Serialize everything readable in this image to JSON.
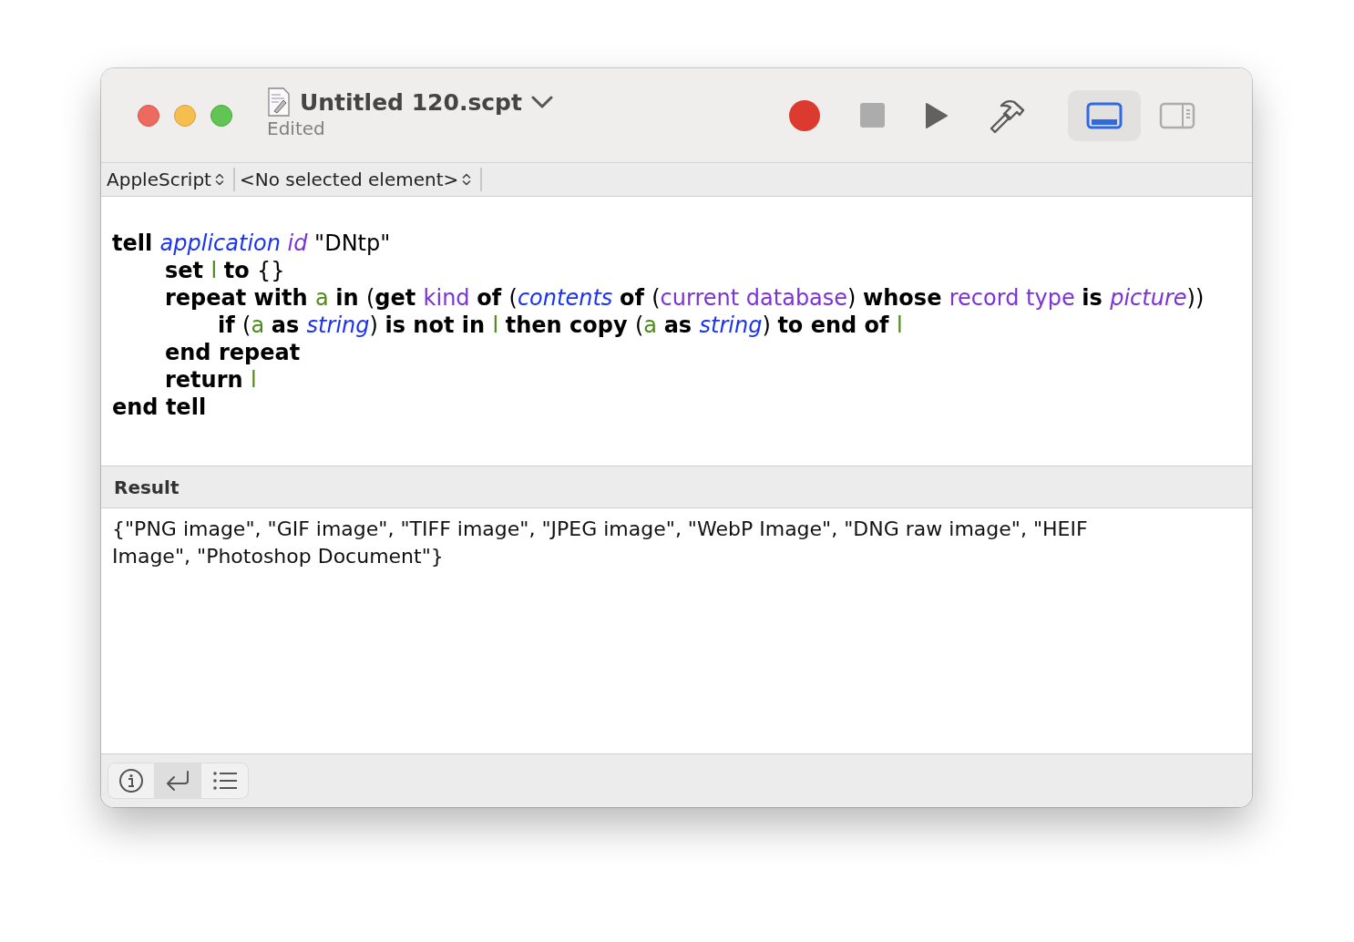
{
  "window": {
    "title": "Untitled 120.scpt",
    "subtitle": "Edited"
  },
  "toolbar": [
    {
      "kind": "record"
    },
    {
      "kind": "stop"
    },
    {
      "kind": "run"
    },
    {
      "kind": "compile"
    }
  ],
  "view_toggle": [
    {
      "kind": "bottom-panel",
      "selected": true
    },
    {
      "kind": "side-panel",
      "selected": false
    }
  ],
  "navigation_bar": [
    {
      "label": "AppleScript"
    },
    {
      "label": "<No selected element>"
    }
  ],
  "script": [
    {
      "tokens": [
        {
          "text": "tell ",
          "kind": "kw"
        },
        {
          "text": "application ",
          "kind": "cls"
        },
        {
          "text": "id ",
          "kind": "enum"
        },
        {
          "text": "\"DNtp\"",
          "kind": "text"
        }
      ],
      "children": [
        {
          "tokens": [
            {
              "text": "set ",
              "kind": "kw"
            },
            {
              "text": "l ",
              "kind": "var"
            },
            {
              "text": "to ",
              "kind": "kw"
            },
            {
              "text": "{}",
              "kind": "text"
            }
          ]
        },
        {
          "tokens": [
            {
              "text": "repeat with ",
              "kind": "kw"
            },
            {
              "text": "a ",
              "kind": "var"
            },
            {
              "text": "in ",
              "kind": "kw"
            },
            {
              "text": "(",
              "kind": "text"
            },
            {
              "text": "get ",
              "kind": "kw"
            },
            {
              "text": "kind ",
              "kind": "prop"
            },
            {
              "text": "of ",
              "kind": "kw"
            },
            {
              "text": "(",
              "kind": "text"
            },
            {
              "text": "contents ",
              "kind": "cls"
            },
            {
              "text": "of ",
              "kind": "kw"
            },
            {
              "text": "(",
              "kind": "text"
            },
            {
              "text": "current database",
              "kind": "prop"
            },
            {
              "text": ") ",
              "kind": "text"
            },
            {
              "text": "whose ",
              "kind": "kw"
            },
            {
              "text": "record type ",
              "kind": "prop"
            },
            {
              "text": "is ",
              "kind": "kw"
            },
            {
              "text": "picture",
              "kind": "enum"
            },
            {
              "text": "))",
              "kind": "text"
            }
          ],
          "children": [
            {
              "tokens": [
                {
                  "text": "if ",
                  "kind": "kw"
                },
                {
                  "text": "(",
                  "kind": "text"
                },
                {
                  "text": "a ",
                  "kind": "var"
                },
                {
                  "text": "as ",
                  "kind": "kw"
                },
                {
                  "text": "string",
                  "kind": "cls"
                },
                {
                  "text": ") ",
                  "kind": "text"
                },
                {
                  "text": "is not in ",
                  "kind": "kw"
                },
                {
                  "text": "l ",
                  "kind": "var"
                },
                {
                  "text": "then copy ",
                  "kind": "kw"
                },
                {
                  "text": "(",
                  "kind": "text"
                },
                {
                  "text": "a ",
                  "kind": "var"
                },
                {
                  "text": "as ",
                  "kind": "kw"
                },
                {
                  "text": "string",
                  "kind": "cls"
                },
                {
                  "text": ") ",
                  "kind": "text"
                },
                {
                  "text": "to end of ",
                  "kind": "kw"
                },
                {
                  "text": "l",
                  "kind": "var"
                }
              ]
            }
          ]
        },
        {
          "tokens": [
            {
              "text": "end repeat",
              "kind": "kw"
            }
          ]
        },
        {
          "tokens": [
            {
              "text": "return ",
              "kind": "kw"
            },
            {
              "text": "l",
              "kind": "var"
            }
          ]
        }
      ]
    },
    {
      "tokens": [
        {
          "text": "end tell",
          "kind": "kw"
        }
      ]
    }
  ],
  "result": {
    "heading": "Result",
    "value": "{\"PNG image\", \"GIF image\", \"TIFF image\", \"JPEG image\", \"WebP Image\", \"DNG raw image\", \"HEIF Image\", \"Photoshop Document\"}"
  },
  "bottom_bar": [
    {
      "kind": "info",
      "selected": false
    },
    {
      "kind": "return",
      "selected": true
    },
    {
      "kind": "list",
      "selected": false
    }
  ]
}
